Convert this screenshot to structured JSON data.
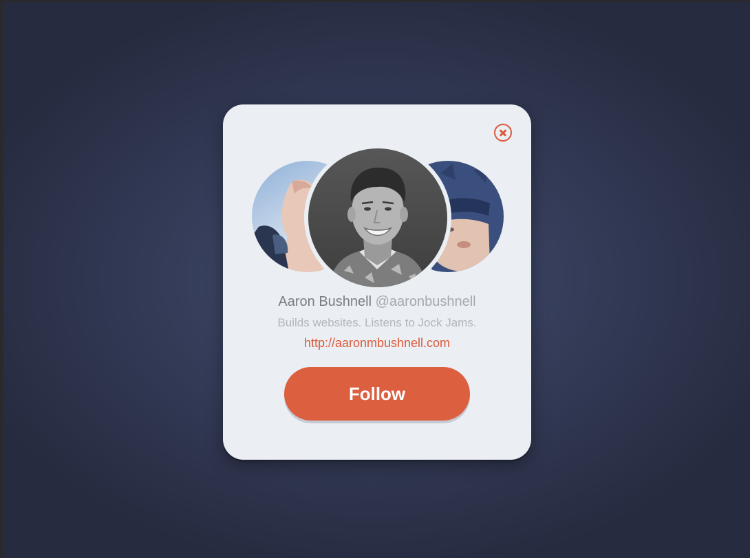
{
  "profile": {
    "name": "Aaron Bushnell",
    "handle": "@aaronbushnell",
    "bio": "Builds websites. Listens to Jock Jams.",
    "url": "http://aaronmbushnell.com"
  },
  "actions": {
    "follow_label": "Follow",
    "close_icon": "close-icon"
  },
  "colors": {
    "accent": "#dc5a3c",
    "card_bg": "#ebeff3",
    "page_bg": "#353d5a",
    "name_text": "#7a7c82",
    "muted_text": "#b2b5ba"
  }
}
